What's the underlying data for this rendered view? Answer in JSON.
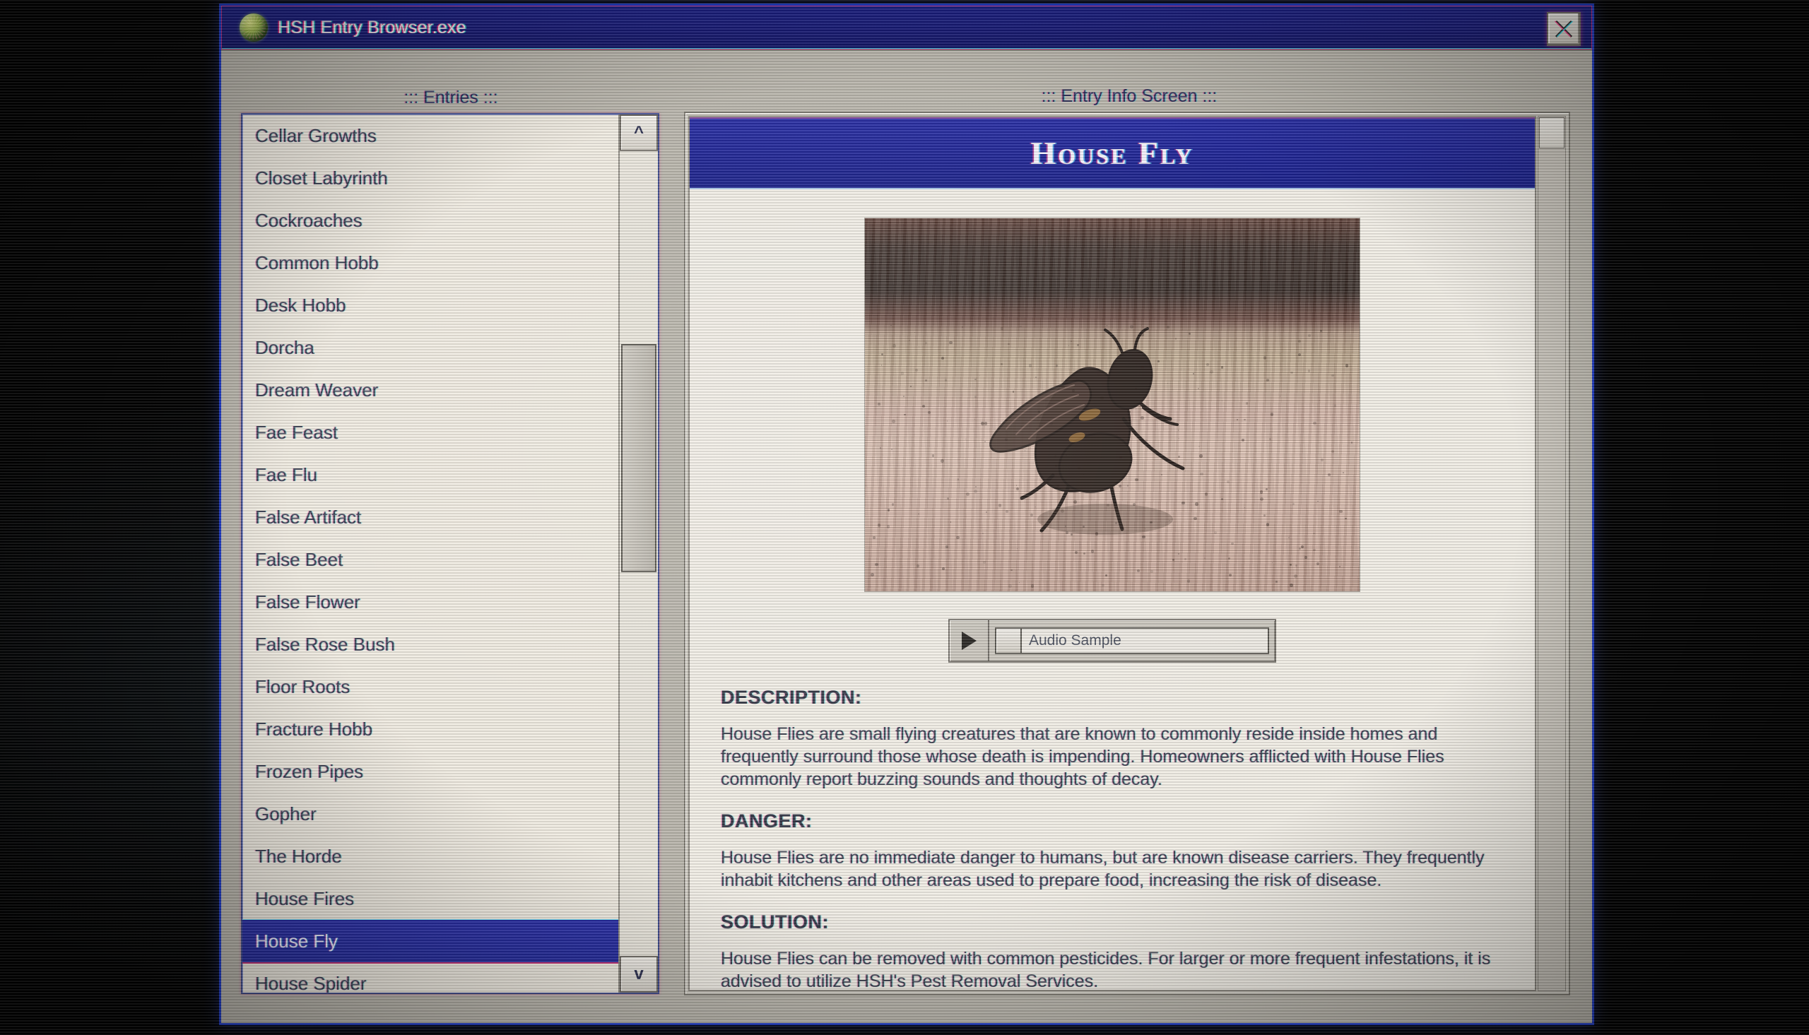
{
  "window": {
    "title": "HSH Entry Browser.exe",
    "icon": "green-orb-icon",
    "close_label": "×",
    "accent_blue": "#1b1f86",
    "frame_border": "#1c39c4"
  },
  "entries_panel": {
    "caption": "::: Entries :::",
    "scroll_up": "^",
    "scroll_down": "v",
    "selected": "House Fly",
    "items": [
      "Cellar Growths",
      "Closet Labyrinth",
      "Cockroaches",
      "Common Hobb",
      "Desk Hobb",
      "Dorcha",
      "Dream Weaver",
      "Fae Feast",
      "Fae Flu",
      "False Artifact",
      "False Beet",
      "False Flower",
      "False Rose Bush",
      "Floor Roots",
      "Fracture Hobb",
      "Frozen Pipes",
      "Gopher",
      "The Horde",
      "House Fires",
      "House Fly",
      "House Spider"
    ]
  },
  "info_panel": {
    "caption": "::: Entry Info Screen :::",
    "entry_title": "House Fly",
    "photo_alt": "house-fly-photograph",
    "audio": {
      "play_label": "play-button",
      "label": "Audio Sample"
    },
    "sections": [
      {
        "heading": "DESCRIPTION:",
        "body": "House Flies are small flying creatures that are known to commonly reside inside homes and frequently surround those whose death is impending. Homeowners afflicted with House Flies commonly report buzzing sounds and thoughts of decay."
      },
      {
        "heading": "DANGER:",
        "body": "House Flies are no immediate danger to humans, but are known disease carriers. They frequently inhabit kitchens and other areas used to prepare food, increasing the risk of disease."
      },
      {
        "heading": "SOLUTION:",
        "body": "House Flies can be removed with common pesticides. For larger or more frequent infestations, it is advised to utilize HSH's Pest Removal Services."
      }
    ]
  }
}
